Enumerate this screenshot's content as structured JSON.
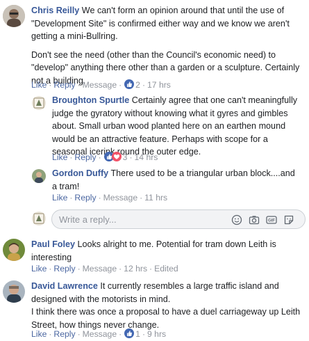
{
  "comments": [
    {
      "author": "Chris Reilly",
      "text1": "We can't form an opinion around that until the use of",
      "text2": "\"Development Site\" is confirmed either way and we know we aren't",
      "text3": "getting a mini-Bullring.",
      "text4": "Don't see the need (other than the Council's economic need) to",
      "text5": "\"develop\" anything there other than a garden or a sculpture. Certainly",
      "text6": "not a building.",
      "like": "Like",
      "reply": "Reply",
      "message": "Message",
      "reactions": "2",
      "time": "17 hrs"
    },
    {
      "author": "Broughton Spurtle",
      "text1": "Certainly agree that one can't meaningfully",
      "text2": "judge the gyratory without knowing what it gyres and gimbles",
      "text3": "about. Small urban wood planted here on an earthen mound",
      "text4": "would be an attractive feature. Perhaps with scope for a",
      "text5": "seasonal icerink round the outer edge.",
      "like": "Like",
      "reply": "Reply",
      "reactions": "3",
      "time": "14 hrs"
    },
    {
      "author": "Gordon Duffy",
      "text1": "There used to be a triangular urban block....and",
      "text2": "a tram!",
      "like": "Like",
      "reply": "Reply",
      "message": "Message",
      "time": "11 hrs"
    },
    {
      "author": "Paul Foley",
      "text1": "Looks alright to me. Potential for tram down Leith is",
      "text2": "interesting",
      "like": "Like",
      "reply": "Reply",
      "message": "Message",
      "time": "12 hrs",
      "edited": "Edited"
    },
    {
      "author": "David Lawrence",
      "text1": "It currently resembles a large traffic island and",
      "text2": "designed with the motorists in mind.",
      "text3": "I think there was once a proposal to have a duel carriageway up Leith",
      "text4": "Street, how things never change.",
      "like": "Like",
      "reply": "Reply",
      "message": "Message",
      "reactions": "1",
      "time": "9 hrs"
    }
  ],
  "reply_input": {
    "placeholder": "Write a reply..."
  },
  "colors": {
    "link": "#385898",
    "meta": "#90949c",
    "like_blue": "#4267b2",
    "love_red": "#f25268"
  }
}
